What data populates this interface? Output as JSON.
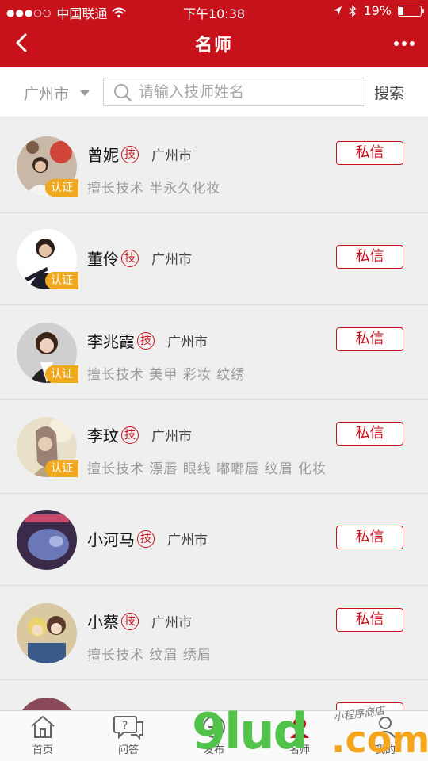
{
  "status_bar": {
    "carrier": "中国联通",
    "time": "下午10:38",
    "battery": "19%",
    "battery_level": 0.19
  },
  "nav": {
    "title": "名师"
  },
  "search": {
    "city": "广州市",
    "placeholder": "请输入技师姓名",
    "button": "搜索"
  },
  "teachers": [
    {
      "name": "曾妮",
      "badge": "技",
      "city": "广州市",
      "certified": "认证",
      "skills": "擅长技术 半永久化妆",
      "message": "私信"
    },
    {
      "name": "董伶",
      "badge": "技",
      "city": "广州市",
      "certified": "认证",
      "skills": "",
      "message": "私信"
    },
    {
      "name": "李兆霞",
      "badge": "技",
      "city": "广州市",
      "certified": "认证",
      "skills": "擅长技术 美甲 彩妆 纹绣",
      "message": "私信"
    },
    {
      "name": "李玟",
      "badge": "技",
      "city": "广州市",
      "certified": "认证",
      "skills": "擅长技术 漂唇 眼线 嘟嘟唇 纹眉 化妆",
      "message": "私信"
    },
    {
      "name": "小河马",
      "badge": "技",
      "city": "广州市",
      "certified": "",
      "skills": "",
      "message": "私信"
    },
    {
      "name": "小蔡",
      "badge": "技",
      "city": "广州市",
      "certified": "",
      "skills": "擅长技术 纹眉 绣眉",
      "message": "私信"
    }
  ],
  "tabs": [
    {
      "label": "首页",
      "icon": "home-icon"
    },
    {
      "label": "问答",
      "icon": "qa-icon"
    },
    {
      "label": "发布",
      "icon": "publish-icon"
    },
    {
      "label": "名师",
      "icon": "teacher-icon"
    },
    {
      "label": "我的",
      "icon": "profile-icon"
    }
  ],
  "watermark": {
    "text": "9lud",
    "domain": ".com",
    "tagline": "小程序商店"
  },
  "colors": {
    "brand_red": "#c8121b",
    "cert_orange": "#f0a91e"
  }
}
